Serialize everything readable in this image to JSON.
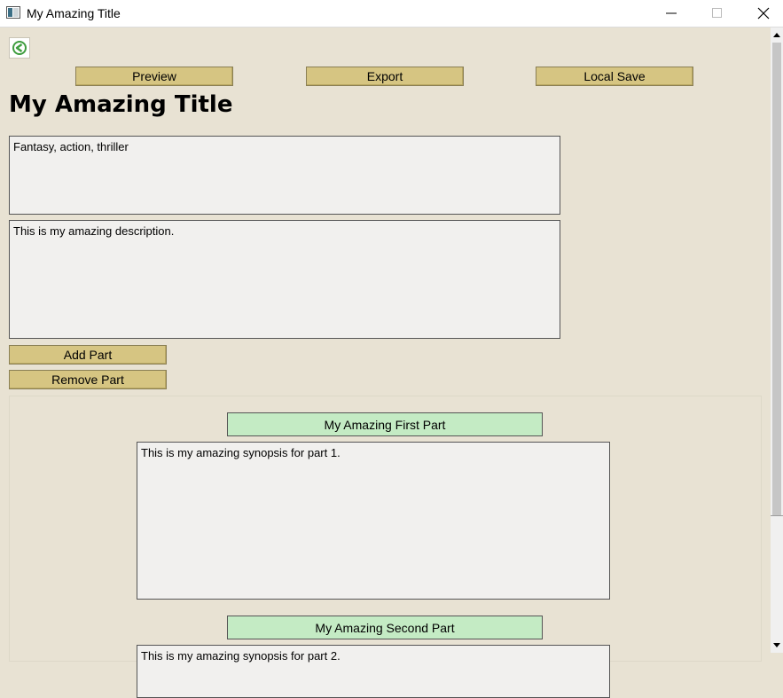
{
  "window": {
    "title": "My Amazing Title"
  },
  "toolbar": {
    "preview_label": "Preview",
    "export_label": "Export",
    "local_save_label": "Local Save"
  },
  "story": {
    "title": "My Amazing Title",
    "tags": "Fantasy, action, thriller",
    "description": "This is my amazing description."
  },
  "parts_controls": {
    "add_label": "Add Part",
    "remove_label": "Remove Part"
  },
  "parts": [
    {
      "title": "My Amazing First Part",
      "synopsis": "This is my amazing synopsis for part 1."
    },
    {
      "title": "My Amazing Second Part",
      "synopsis": "This is my amazing synopsis for part 2."
    }
  ],
  "colors": {
    "background": "#e8e2d3",
    "button": "#d6c582",
    "part_title": "#c4ebc4",
    "textbox": "#f1f0ee",
    "back_icon": "#3f9d3f"
  },
  "icons": {
    "back": "back-arrow-icon",
    "app": "app-window-icon"
  }
}
